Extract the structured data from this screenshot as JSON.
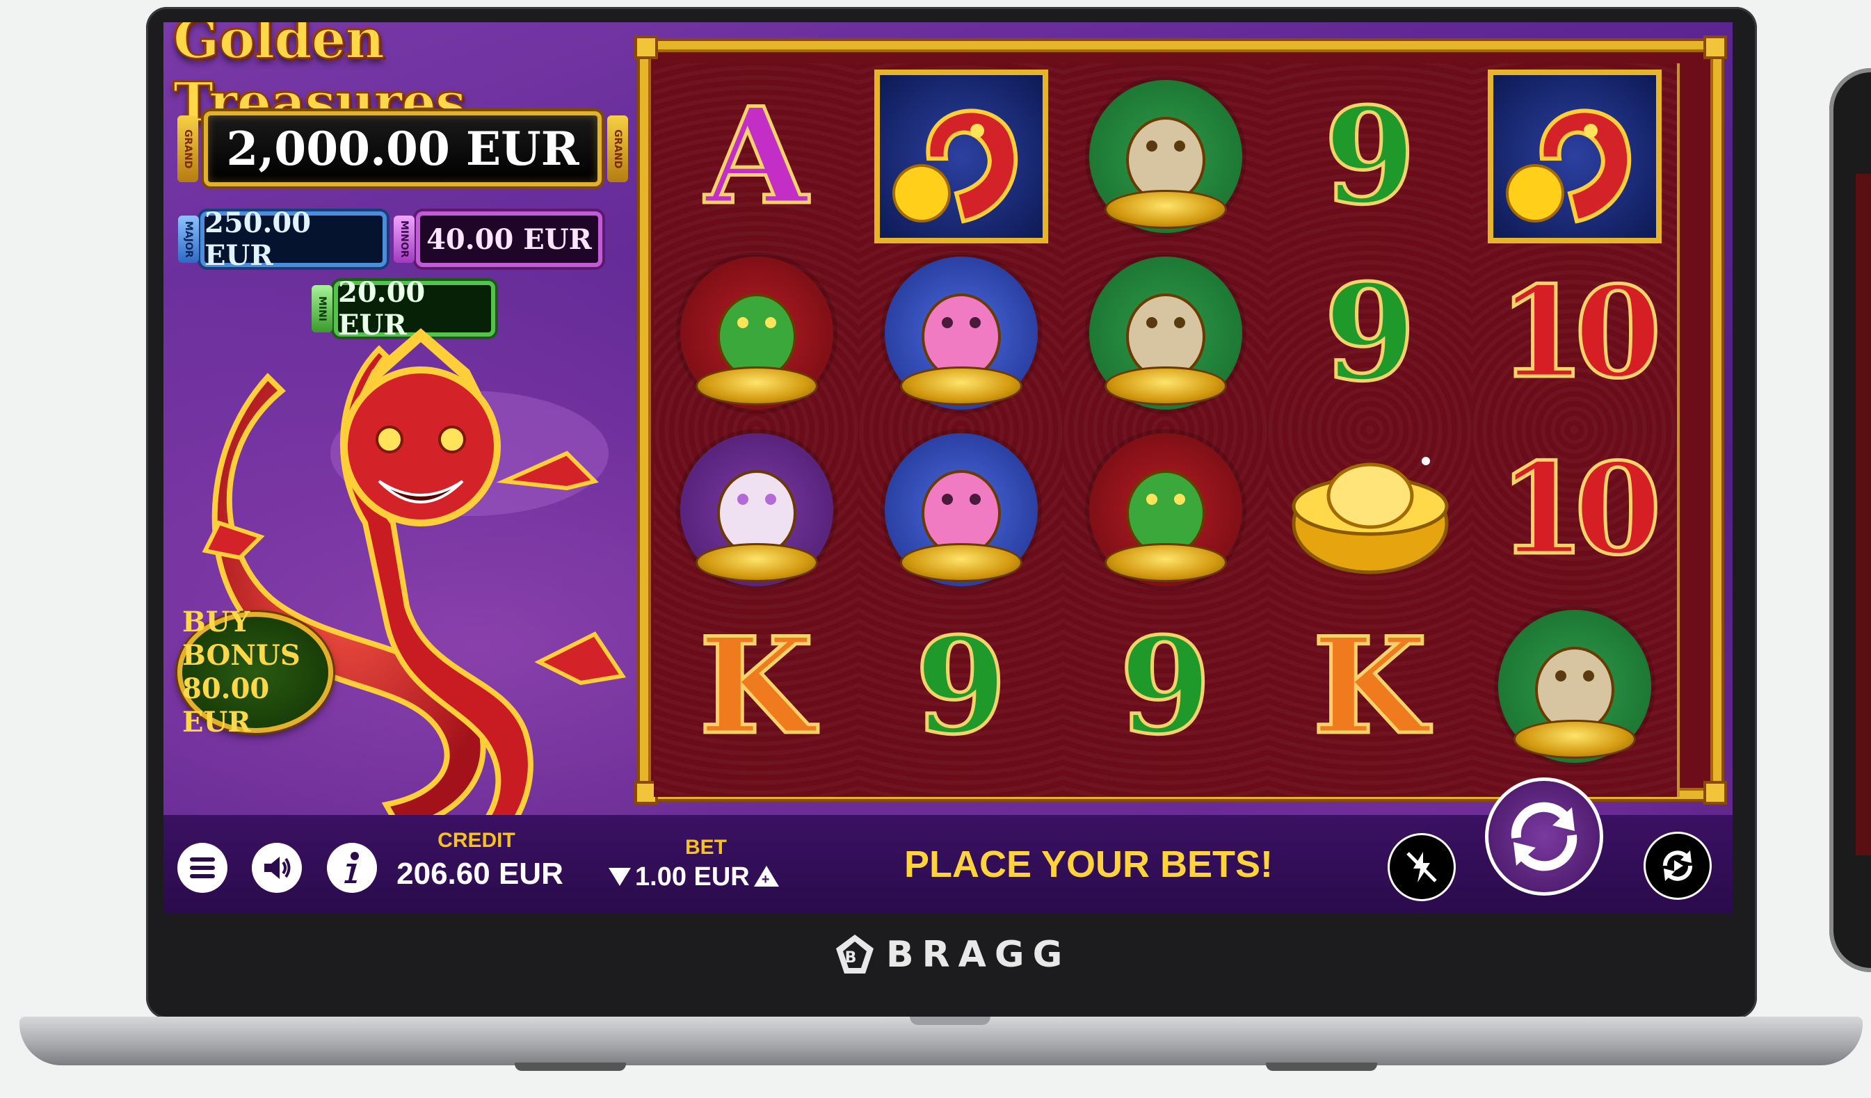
{
  "game": {
    "title": "Golden Treasures",
    "jackpots": {
      "grand": {
        "label": "GRAND",
        "value": "2,000.00 EUR"
      },
      "major": {
        "label": "MAJOR",
        "value": "250.00 EUR"
      },
      "minor": {
        "label": "MINOR",
        "value": "40.00 EUR"
      },
      "mini": {
        "label": "MINI",
        "value": "20.00 EUR"
      }
    },
    "buy_bonus": {
      "line1": "BUY BONUS",
      "line2": "80.00 EUR"
    }
  },
  "reels": [
    [
      {
        "symbol": "A"
      },
      {
        "symbol": "toad-icon"
      },
      {
        "symbol": "foo-dog-icon"
      },
      {
        "symbol": "K"
      }
    ],
    [
      {
        "symbol": "dragon-icon"
      },
      {
        "symbol": "pig-icon"
      },
      {
        "symbol": "pig-icon"
      },
      {
        "symbol": "9"
      }
    ],
    [
      {
        "symbol": "rat-icon"
      },
      {
        "symbol": "rat-icon"
      },
      {
        "symbol": "toad-icon"
      },
      {
        "symbol": "9"
      }
    ],
    [
      {
        "symbol": "9"
      },
      {
        "symbol": "9"
      },
      {
        "symbol": "gold-ingot-icon"
      },
      {
        "symbol": "K"
      }
    ],
    [
      {
        "symbol": "dragon-icon"
      },
      {
        "symbol": "10"
      },
      {
        "symbol": "10"
      },
      {
        "symbol": "rat-icon"
      }
    ]
  ],
  "bottom_bar": {
    "credit_label": "CREDIT",
    "credit_value": "206.60 EUR",
    "bet_label": "BET",
    "bet_value": "1.00 EUR",
    "status": "PLACE YOUR BETS!"
  },
  "brand": {
    "name": "BRAGG"
  },
  "colors": {
    "gold": "#e7b52a",
    "purple": "#5b2490",
    "reel_red": "#6a0c19",
    "status_yellow": "#ffd43b"
  }
}
